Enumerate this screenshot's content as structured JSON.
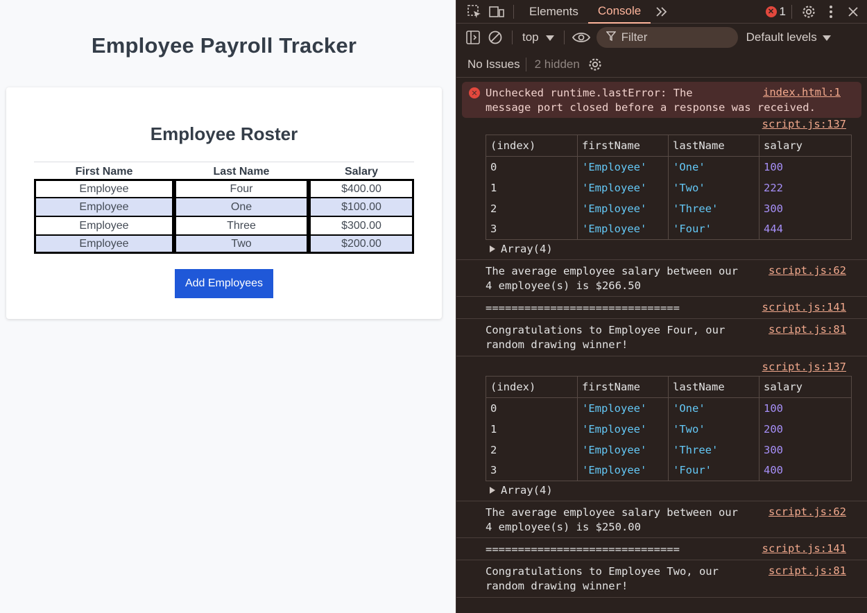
{
  "app": {
    "title": "Employee Payroll Tracker",
    "card_title": "Employee Roster",
    "columns": [
      "First Name",
      "Last Name",
      "Salary"
    ],
    "rows": [
      [
        "Employee",
        "Four",
        "$400.00"
      ],
      [
        "Employee",
        "One",
        "$100.00"
      ],
      [
        "Employee",
        "Three",
        "$300.00"
      ],
      [
        "Employee",
        "Two",
        "$200.00"
      ]
    ],
    "add_button": "Add Employees"
  },
  "devtools": {
    "tabs": {
      "elements": "Elements",
      "console": "Console"
    },
    "error_count": "1",
    "toolbar": {
      "context": "top",
      "filter_placeholder": "Filter",
      "levels": "Default levels"
    },
    "issues": {
      "no_issues": "No Issues",
      "hidden": "2 hidden"
    },
    "colors": {
      "accent": "#ffb59c",
      "string": "#64c8f6",
      "number": "#a68ff7",
      "error": "#e2483d"
    },
    "messages": {
      "error_text": "Unchecked runtime.lastError: The\nmessage port closed before a response was received.",
      "error_src": "index.html:1",
      "table1_src": "script.js:137",
      "table_headers": [
        "(index)",
        "firstName",
        "lastName",
        "salary"
      ],
      "table1_rows": [
        [
          "0",
          "'Employee'",
          "'One'",
          "100"
        ],
        [
          "1",
          "'Employee'",
          "'Two'",
          "222"
        ],
        [
          "2",
          "'Employee'",
          "'Three'",
          "300"
        ],
        [
          "3",
          "'Employee'",
          "'Four'",
          "444"
        ]
      ],
      "array_label": "Array(4)",
      "avg1_text": "The average employee salary between our\n4 employee(s) is $266.50",
      "avg_src": "script.js:62",
      "divider_text": "==============================",
      "divider_src": "script.js:141",
      "winner1_text": "Congratulations to Employee Four, our\nrandom drawing winner!",
      "winner_src": "script.js:81",
      "table2_src": "script.js:137",
      "table2_rows": [
        [
          "0",
          "'Employee'",
          "'One'",
          "100"
        ],
        [
          "1",
          "'Employee'",
          "'Two'",
          "200"
        ],
        [
          "2",
          "'Employee'",
          "'Three'",
          "300"
        ],
        [
          "3",
          "'Employee'",
          "'Four'",
          "400"
        ]
      ],
      "avg2_text": "The average employee salary between our\n4 employee(s) is $250.00",
      "winner2_text": "Congratulations to Employee Two, our\nrandom drawing winner!"
    }
  }
}
